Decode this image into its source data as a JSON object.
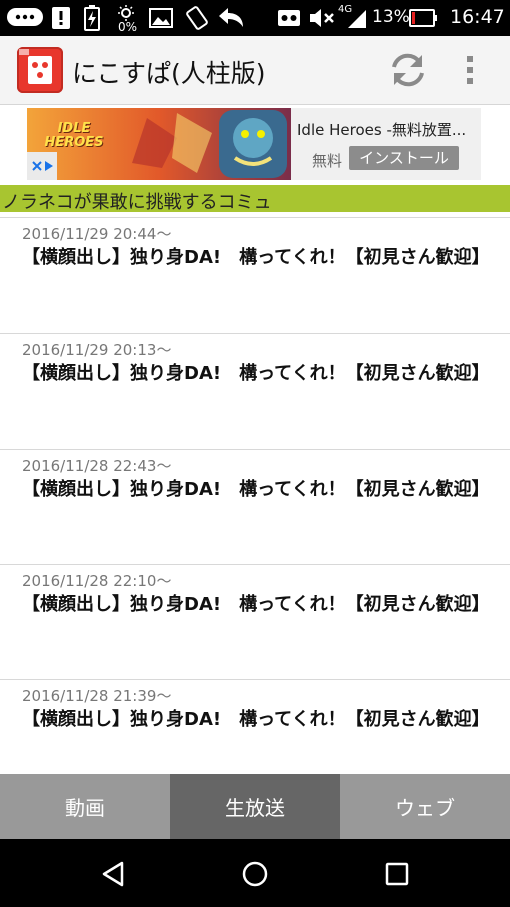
{
  "status_bar": {
    "battery_text": "13%",
    "network_text": "4G",
    "time": "16:47",
    "percent_small": "0%"
  },
  "app_bar": {
    "title": "にこすぱ(人柱版)"
  },
  "ad": {
    "title": "Idle Heroes -無料放置...",
    "price": "無料",
    "install_label": "インストール",
    "image_text": "IDLE HEROES"
  },
  "community": {
    "name": "ノラネコが果敢に挑戦するコミュ"
  },
  "broadcasts": [
    {
      "date": "2016/11/29 20:44〜",
      "title": "【横顔出し】独り身DA!　構ってくれ！【初見さん歓迎】"
    },
    {
      "date": "2016/11/29 20:13〜",
      "title": "【横顔出し】独り身DA!　構ってくれ！【初見さん歓迎】"
    },
    {
      "date": "2016/11/28 22:43〜",
      "title": "【横顔出し】独り身DA!　構ってくれ！【初見さん歓迎】"
    },
    {
      "date": "2016/11/28 22:10〜",
      "title": "【横顔出し】独り身DA!　構ってくれ！【初見さん歓迎】"
    },
    {
      "date": "2016/11/28 21:39〜",
      "title": "【横顔出し】独り身DA!　構ってくれ！【初見さん歓迎】"
    }
  ],
  "tabs": [
    {
      "label": "動画",
      "active": false
    },
    {
      "label": "生放送",
      "active": true
    },
    {
      "label": "ウェブ",
      "active": false
    }
  ],
  "colors": {
    "community_bar": "#a8c530",
    "logo": "#e8372c",
    "tab_active": "#666666",
    "tab_inactive": "#999999"
  }
}
